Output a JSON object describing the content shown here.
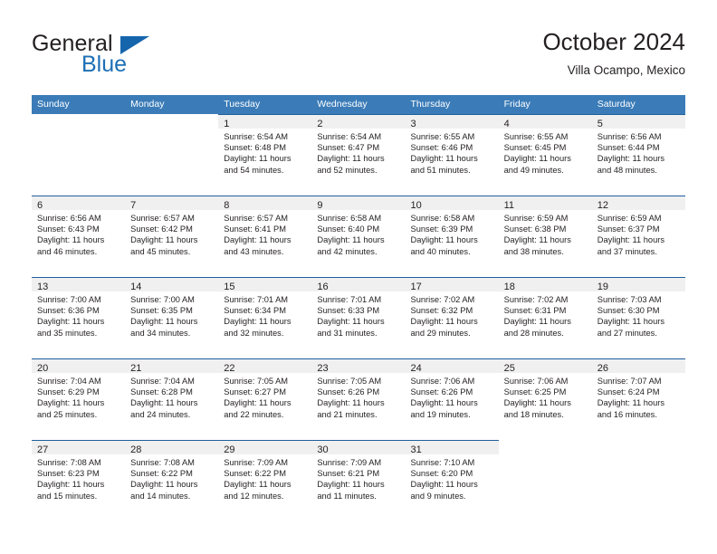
{
  "brand": {
    "name_top": "General",
    "name_bottom": "Blue",
    "accent_color": "#1565ad",
    "text_color": "#231f20"
  },
  "header": {
    "title": "October 2024",
    "subtitle": "Villa Ocampo, Mexico"
  },
  "theme": {
    "header_bar_color": "#3b7cb8",
    "row_rule_color": "#1f5f9e",
    "daynum_band_color": "#f0f0f0",
    "page_background": "#ffffff"
  },
  "weekdays": [
    "Sunday",
    "Monday",
    "Tuesday",
    "Wednesday",
    "Thursday",
    "Friday",
    "Saturday"
  ],
  "weeks": [
    [
      {
        "day": "",
        "lines": []
      },
      {
        "day": "",
        "lines": []
      },
      {
        "day": "1",
        "lines": [
          "Sunrise: 6:54 AM",
          "Sunset: 6:48 PM",
          "Daylight: 11 hours",
          "and 54 minutes."
        ]
      },
      {
        "day": "2",
        "lines": [
          "Sunrise: 6:54 AM",
          "Sunset: 6:47 PM",
          "Daylight: 11 hours",
          "and 52 minutes."
        ]
      },
      {
        "day": "3",
        "lines": [
          "Sunrise: 6:55 AM",
          "Sunset: 6:46 PM",
          "Daylight: 11 hours",
          "and 51 minutes."
        ]
      },
      {
        "day": "4",
        "lines": [
          "Sunrise: 6:55 AM",
          "Sunset: 6:45 PM",
          "Daylight: 11 hours",
          "and 49 minutes."
        ]
      },
      {
        "day": "5",
        "lines": [
          "Sunrise: 6:56 AM",
          "Sunset: 6:44 PM",
          "Daylight: 11 hours",
          "and 48 minutes."
        ]
      }
    ],
    [
      {
        "day": "6",
        "lines": [
          "Sunrise: 6:56 AM",
          "Sunset: 6:43 PM",
          "Daylight: 11 hours",
          "and 46 minutes."
        ]
      },
      {
        "day": "7",
        "lines": [
          "Sunrise: 6:57 AM",
          "Sunset: 6:42 PM",
          "Daylight: 11 hours",
          "and 45 minutes."
        ]
      },
      {
        "day": "8",
        "lines": [
          "Sunrise: 6:57 AM",
          "Sunset: 6:41 PM",
          "Daylight: 11 hours",
          "and 43 minutes."
        ]
      },
      {
        "day": "9",
        "lines": [
          "Sunrise: 6:58 AM",
          "Sunset: 6:40 PM",
          "Daylight: 11 hours",
          "and 42 minutes."
        ]
      },
      {
        "day": "10",
        "lines": [
          "Sunrise: 6:58 AM",
          "Sunset: 6:39 PM",
          "Daylight: 11 hours",
          "and 40 minutes."
        ]
      },
      {
        "day": "11",
        "lines": [
          "Sunrise: 6:59 AM",
          "Sunset: 6:38 PM",
          "Daylight: 11 hours",
          "and 38 minutes."
        ]
      },
      {
        "day": "12",
        "lines": [
          "Sunrise: 6:59 AM",
          "Sunset: 6:37 PM",
          "Daylight: 11 hours",
          "and 37 minutes."
        ]
      }
    ],
    [
      {
        "day": "13",
        "lines": [
          "Sunrise: 7:00 AM",
          "Sunset: 6:36 PM",
          "Daylight: 11 hours",
          "and 35 minutes."
        ]
      },
      {
        "day": "14",
        "lines": [
          "Sunrise: 7:00 AM",
          "Sunset: 6:35 PM",
          "Daylight: 11 hours",
          "and 34 minutes."
        ]
      },
      {
        "day": "15",
        "lines": [
          "Sunrise: 7:01 AM",
          "Sunset: 6:34 PM",
          "Daylight: 11 hours",
          "and 32 minutes."
        ]
      },
      {
        "day": "16",
        "lines": [
          "Sunrise: 7:01 AM",
          "Sunset: 6:33 PM",
          "Daylight: 11 hours",
          "and 31 minutes."
        ]
      },
      {
        "day": "17",
        "lines": [
          "Sunrise: 7:02 AM",
          "Sunset: 6:32 PM",
          "Daylight: 11 hours",
          "and 29 minutes."
        ]
      },
      {
        "day": "18",
        "lines": [
          "Sunrise: 7:02 AM",
          "Sunset: 6:31 PM",
          "Daylight: 11 hours",
          "and 28 minutes."
        ]
      },
      {
        "day": "19",
        "lines": [
          "Sunrise: 7:03 AM",
          "Sunset: 6:30 PM",
          "Daylight: 11 hours",
          "and 27 minutes."
        ]
      }
    ],
    [
      {
        "day": "20",
        "lines": [
          "Sunrise: 7:04 AM",
          "Sunset: 6:29 PM",
          "Daylight: 11 hours",
          "and 25 minutes."
        ]
      },
      {
        "day": "21",
        "lines": [
          "Sunrise: 7:04 AM",
          "Sunset: 6:28 PM",
          "Daylight: 11 hours",
          "and 24 minutes."
        ]
      },
      {
        "day": "22",
        "lines": [
          "Sunrise: 7:05 AM",
          "Sunset: 6:27 PM",
          "Daylight: 11 hours",
          "and 22 minutes."
        ]
      },
      {
        "day": "23",
        "lines": [
          "Sunrise: 7:05 AM",
          "Sunset: 6:26 PM",
          "Daylight: 11 hours",
          "and 21 minutes."
        ]
      },
      {
        "day": "24",
        "lines": [
          "Sunrise: 7:06 AM",
          "Sunset: 6:26 PM",
          "Daylight: 11 hours",
          "and 19 minutes."
        ]
      },
      {
        "day": "25",
        "lines": [
          "Sunrise: 7:06 AM",
          "Sunset: 6:25 PM",
          "Daylight: 11 hours",
          "and 18 minutes."
        ]
      },
      {
        "day": "26",
        "lines": [
          "Sunrise: 7:07 AM",
          "Sunset: 6:24 PM",
          "Daylight: 11 hours",
          "and 16 minutes."
        ]
      }
    ],
    [
      {
        "day": "27",
        "lines": [
          "Sunrise: 7:08 AM",
          "Sunset: 6:23 PM",
          "Daylight: 11 hours",
          "and 15 minutes."
        ]
      },
      {
        "day": "28",
        "lines": [
          "Sunrise: 7:08 AM",
          "Sunset: 6:22 PM",
          "Daylight: 11 hours",
          "and 14 minutes."
        ]
      },
      {
        "day": "29",
        "lines": [
          "Sunrise: 7:09 AM",
          "Sunset: 6:22 PM",
          "Daylight: 11 hours",
          "and 12 minutes."
        ]
      },
      {
        "day": "30",
        "lines": [
          "Sunrise: 7:09 AM",
          "Sunset: 6:21 PM",
          "Daylight: 11 hours",
          "and 11 minutes."
        ]
      },
      {
        "day": "31",
        "lines": [
          "Sunrise: 7:10 AM",
          "Sunset: 6:20 PM",
          "Daylight: 11 hours",
          "and 9 minutes."
        ]
      },
      {
        "day": "",
        "lines": []
      },
      {
        "day": "",
        "lines": []
      }
    ]
  ]
}
